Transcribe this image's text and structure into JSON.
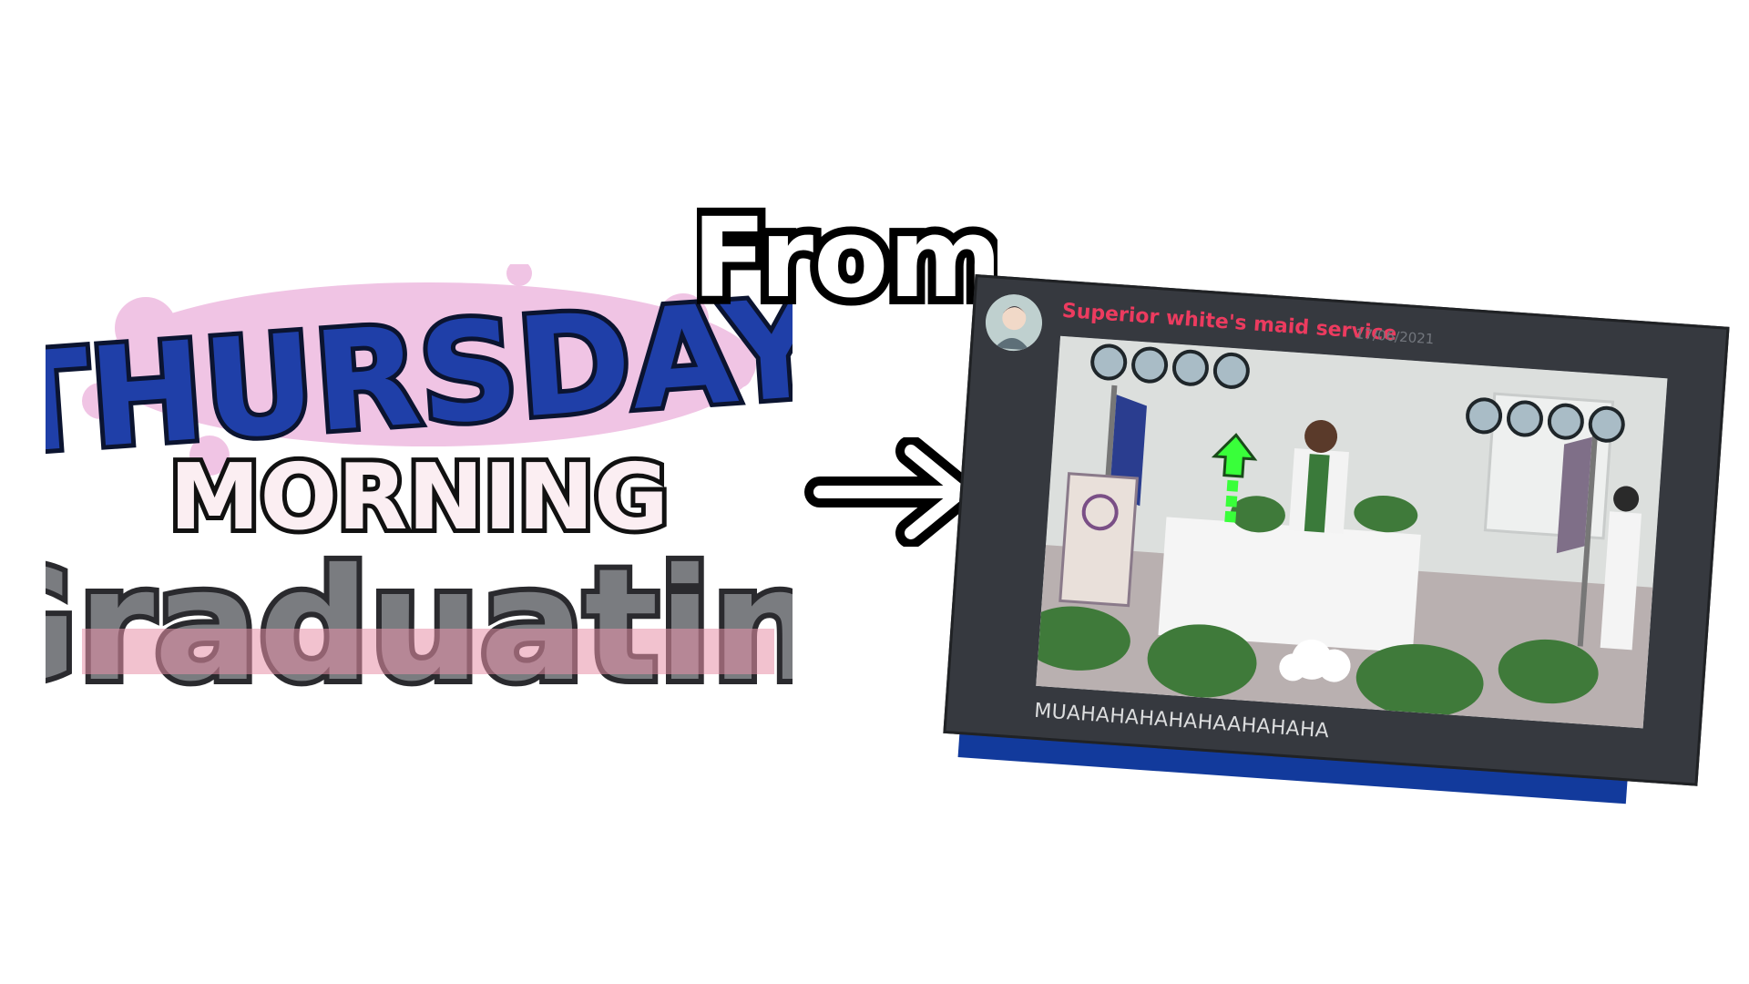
{
  "logo": {
    "line1": "THURSDAY",
    "line2": "MORNING",
    "line3": "Graduatin'",
    "colors": {
      "blue": "#1f3fa8",
      "pink": "#e890a8",
      "splash": "#f0c4e4",
      "stone": "#7a7c80"
    }
  },
  "heading": {
    "from": "From"
  },
  "arrow": {
    "icon": "right-arrow-icon"
  },
  "discord": {
    "username": "Superior white's maid service",
    "timestamp": "17/06/2021",
    "message": "MUAHAHAHAHAHAAHAHAHA",
    "colors": {
      "username": "#ec3b5f",
      "background": "#36393f"
    },
    "video": {
      "caption": "",
      "arrows_left": [
        "left",
        "down",
        "up",
        "right"
      ],
      "arrows_right": [
        "left",
        "down",
        "up",
        "right"
      ]
    }
  }
}
